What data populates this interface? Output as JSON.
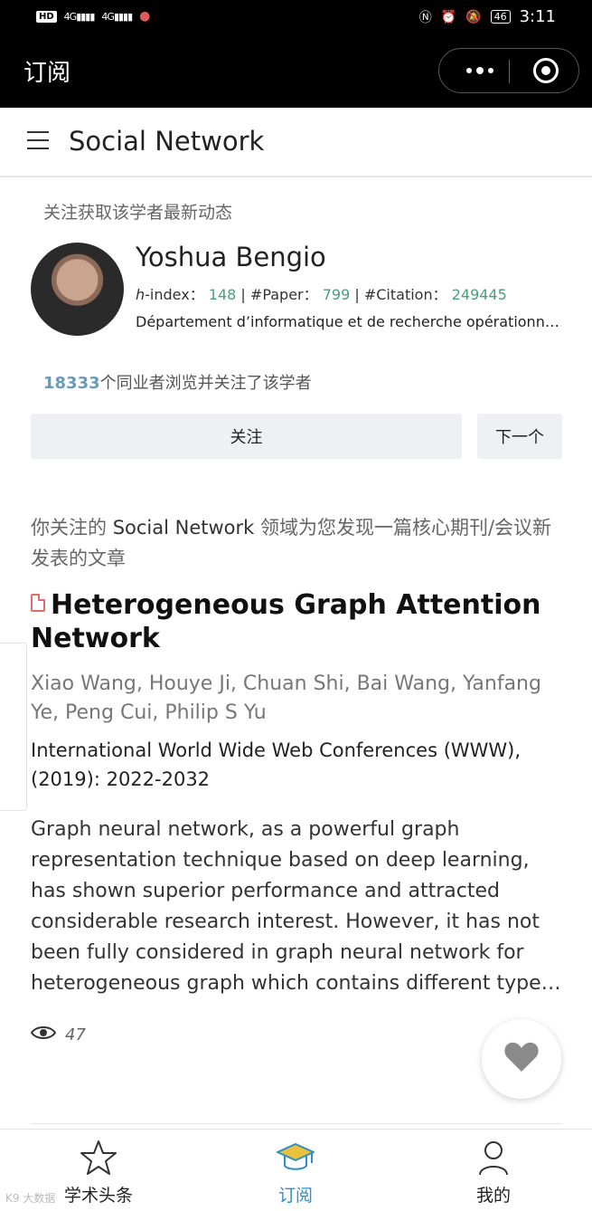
{
  "status_bar": {
    "chip": "HD",
    "signal1": "4G",
    "signal2": "4G",
    "battery": "46",
    "time": "3:11"
  },
  "appbar": {
    "title": "订阅"
  },
  "page_header": {
    "title": "Social Network"
  },
  "scholar": {
    "hint": "关注获取该学者最新动态",
    "name": "Yoshua Bengio",
    "hindex_label": "h",
    "hindex_suffix": "-index：",
    "hindex_value": "148",
    "sep": " | ",
    "paper_label": "#Paper：",
    "paper_value": "799",
    "citation_label": "#Citation：",
    "citation_value": "249445",
    "affiliation": "Département d’informatique et de recherche opérationnelle",
    "views_count": "18333",
    "views_text": "个同业者浏览并关注了该学者",
    "follow_button": "关注",
    "next_button": "下一个"
  },
  "article": {
    "discover_prefix": "你关注的 ",
    "discover_field": "Social Network",
    "discover_suffix": " 领域为您发现一篇核心期刊/会议新发表的文章",
    "title": "Heterogeneous Graph Attention Network",
    "authors": "Xiao Wang, Houye Ji, Chuan Shi, Bai Wang, Yanfang Ye, Peng Cui, Philip S Yu",
    "venue": "International World Wide Web Conferences (WWW), (2019): 2022-2032",
    "abstract_lines": [
      "Graph neural network, as a powerful graph",
      "representation technique based on deep learning,",
      "has shown superior performance and attracted",
      "considerable research interest. However, it has not",
      "been fully considered in graph neural network for",
      "heterogeneous graph which contains different types of nodes and links."
    ],
    "view_count": "47"
  },
  "tabbar": {
    "items": [
      {
        "label": "学术头条",
        "icon": "star-icon"
      },
      {
        "label": "订阅",
        "icon": "graduation-cap-icon"
      },
      {
        "label": "我的",
        "icon": "person-icon"
      }
    ],
    "active_color": "#2e8ec8"
  },
  "watermark": "K9 大数据"
}
